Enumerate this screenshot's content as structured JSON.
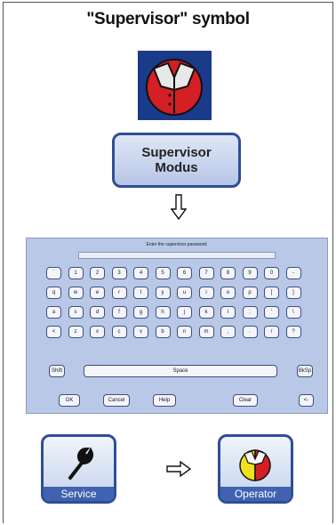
{
  "title": "\"Supervisor\" symbol",
  "supervisor_button": {
    "line1": "Supervisor",
    "line2": "Modus"
  },
  "keyboard": {
    "prompt": "Enter the supervisor password:",
    "row1": [
      "`",
      "1",
      "2",
      "3",
      "4",
      "5",
      "6",
      "7",
      "8",
      "9",
      "0",
      "-"
    ],
    "row2": [
      "q",
      "w",
      "e",
      "r",
      "t",
      "y",
      "u",
      "i",
      "o",
      "p",
      "[",
      "]"
    ],
    "row3": [
      "a",
      "s",
      "d",
      "f",
      "g",
      "h",
      "j",
      "k",
      "l",
      ";",
      "'",
      "\\"
    ],
    "row4": [
      "<",
      "z",
      "x",
      "c",
      "v",
      "b",
      "n",
      "m",
      ",",
      ".",
      "/",
      "?"
    ],
    "shift_label": "Shift",
    "space_label": "Space",
    "bksp_label": "BkSp",
    "ok_label": "OK",
    "cancel_label": "Cancel",
    "help_label": "Help",
    "clear_label": "Clear",
    "enter_label": "<-"
  },
  "service_button": {
    "label": "Service",
    "icon": "wrench-icon"
  },
  "operator_button": {
    "label": "Operator",
    "icon": "operator-shirt-icon"
  },
  "colors": {
    "accent": "#2f4e96",
    "supervisor_red": "#d41f25",
    "operator_yellow": "#f0e11c"
  }
}
